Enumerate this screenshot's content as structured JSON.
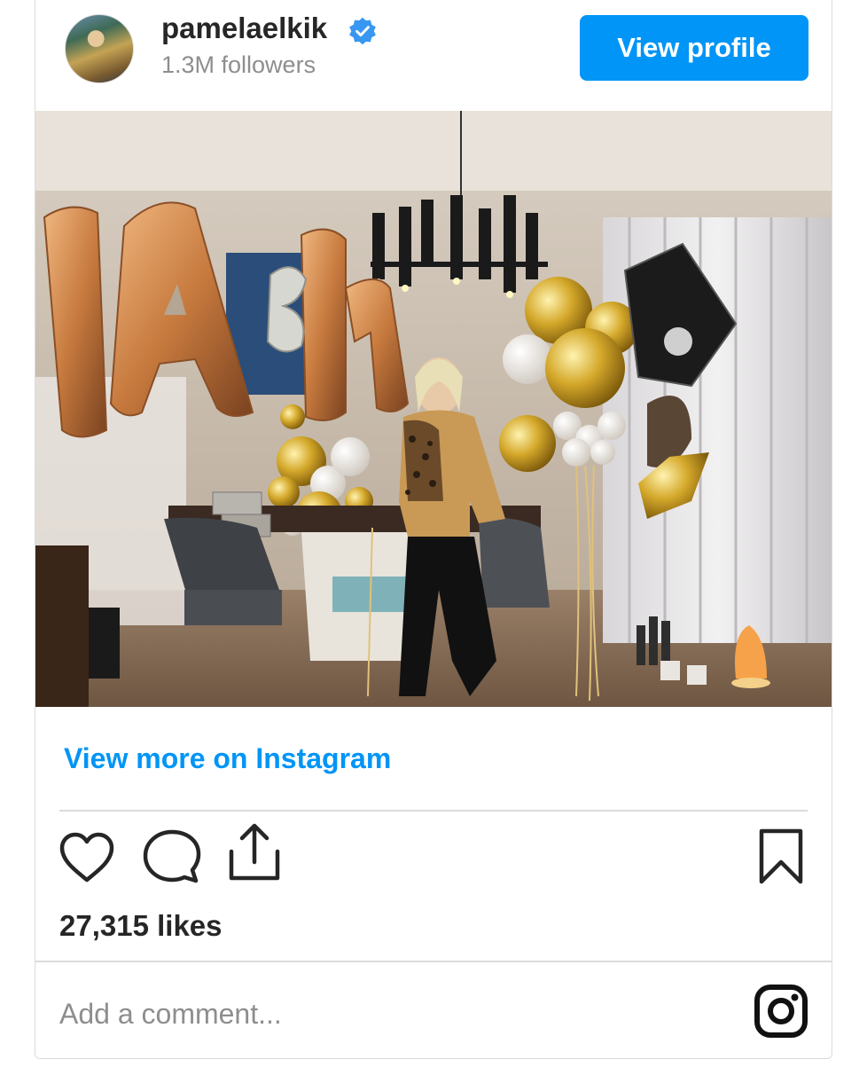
{
  "profile": {
    "username": "pamelaelkik",
    "followers": "1.3M followers",
    "view_profile_label": "View profile",
    "verified_icon": "verified-badge-icon",
    "brand_color": "#0095f6"
  },
  "post": {
    "image_icon": "photo",
    "view_more_label": "View more on Instagram",
    "likes": "27,315 likes"
  },
  "actions": {
    "icons": [
      "heart-icon",
      "comment-icon",
      "share-icon",
      "bookmark-icon"
    ]
  },
  "comment": {
    "placeholder": "Add a comment...",
    "instagram_icon": "instagram-logo-icon"
  }
}
